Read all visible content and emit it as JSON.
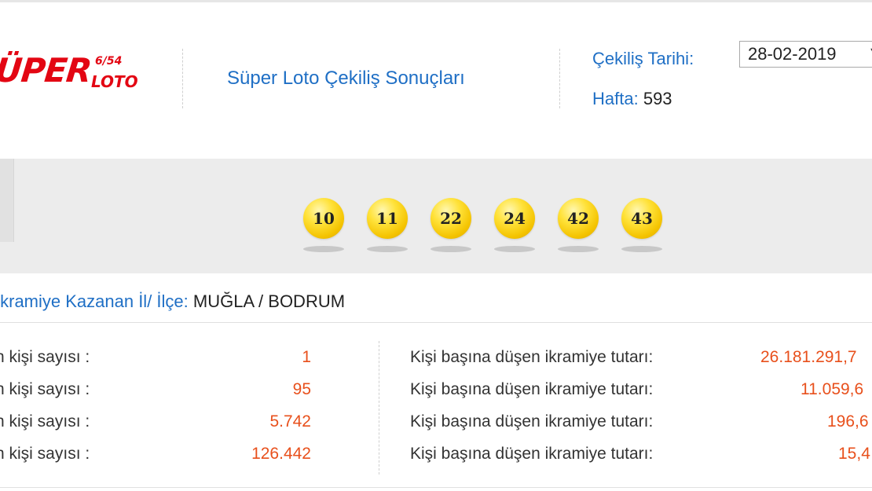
{
  "logo": {
    "main": "ÜPER",
    "fraction": "6/54",
    "sub": "LOTO"
  },
  "header": {
    "title": "Süper Loto Çekiliş Sonuçları",
    "draw_date_label": "Çekiliş Tarihi:",
    "draw_date_value": "28-02-2019",
    "week_label": "Hafta:",
    "week_value": "593"
  },
  "numbers": [
    "10",
    "11",
    "22",
    "24",
    "42",
    "43"
  ],
  "ball_color": "#f4c300",
  "winner_location": {
    "label": "İkramiye Kazanan İl/ İlçe:",
    "value": "MUĞLA / BODRUM"
  },
  "results": [
    {
      "label": "n kişi sayısı :",
      "count": "1",
      "prize_label": "Kişi başına düşen ikramiye tutarı:",
      "amount": "26.181.291,7"
    },
    {
      "label": "n kişi sayısı :",
      "count": "95",
      "prize_label": "Kişi başına düşen ikramiye tutarı:",
      "amount": "11.059,6"
    },
    {
      "label": "n kişi sayısı :",
      "count": "5.742",
      "prize_label": "Kişi başına düşen ikramiye tutarı:",
      "amount": "196,6"
    },
    {
      "label": "n kişi sayısı :",
      "count": "126.442",
      "prize_label": "Kişi başına düşen ikramiye tutarı:",
      "amount": "15,4"
    }
  ],
  "colors": {
    "accent_blue": "#1f6fc5",
    "value_orange": "#e8501c",
    "logo_red": "#e30613"
  }
}
